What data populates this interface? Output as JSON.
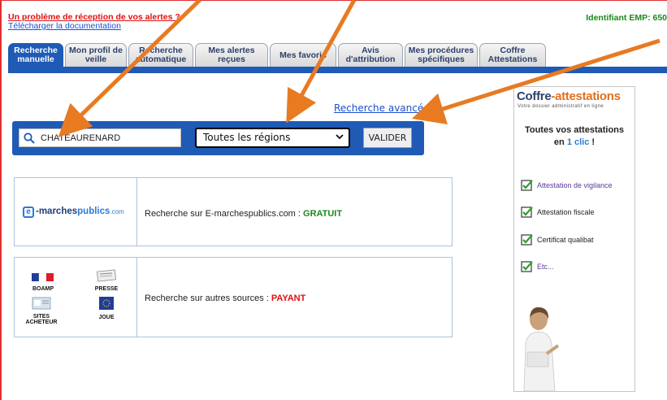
{
  "header": {
    "alert_link": "Un problème de réception de vos alertes ?",
    "doc_link": "Télécharger la documentation",
    "identifier": "Identifiant EMP: 650"
  },
  "tabs": [
    {
      "line1": "Recherche",
      "line2": "manuelle",
      "active": true
    },
    {
      "line1": "Mon profil de",
      "line2": "veille",
      "active": false
    },
    {
      "line1": "Recherche",
      "line2": "automatique",
      "active": false
    },
    {
      "line1": "Mes alertes",
      "line2": "reçues",
      "active": false
    },
    {
      "line1": "Mes favoris",
      "line2": "",
      "active": false
    },
    {
      "line1": "Avis",
      "line2": "d'attribution",
      "active": false
    },
    {
      "line1": "Mes procédures",
      "line2": "spécifiques",
      "active": false
    },
    {
      "line1": "Coffre",
      "line2": "Attestations",
      "active": false
    }
  ],
  "search": {
    "advanced_link": "Recherche avancée",
    "keyword_value": "CHATEAURENARD",
    "region_selected": "Toutes les régions",
    "submit_label": "VALIDER"
  },
  "sources": {
    "free": {
      "logo_letter": "e",
      "logo_text_1": "-marches",
      "logo_text_2": "publics",
      "logo_text_3": ".com",
      "text": "Recherche sur E-marchespublics.com : ",
      "badge": "GRATUIT"
    },
    "paid": {
      "items": [
        "BOAMP",
        "PRESSE",
        "SITES ACHETEUR",
        "JOUE"
      ],
      "text": "Recherche sur autres sources : ",
      "badge": "PAYANT"
    }
  },
  "sidebar": {
    "brand_1": "Coffre",
    "brand_2": "-attestations",
    "tagline": "Votre dossier administratif en ligne",
    "headline_1": "Toutes vos attestations",
    "headline_2a": "en ",
    "headline_2b": "1 clic",
    "headline_2c": " !",
    "items": [
      "Attestation de vigilance",
      "Attestation fiscale",
      "Certificat qualibat",
      "Etc..."
    ]
  },
  "colors": {
    "accent_blue": "#1f5ab5",
    "arrow_orange": "#e87a22",
    "free_green": "#1a8a1a",
    "paid_red": "#e01010"
  }
}
